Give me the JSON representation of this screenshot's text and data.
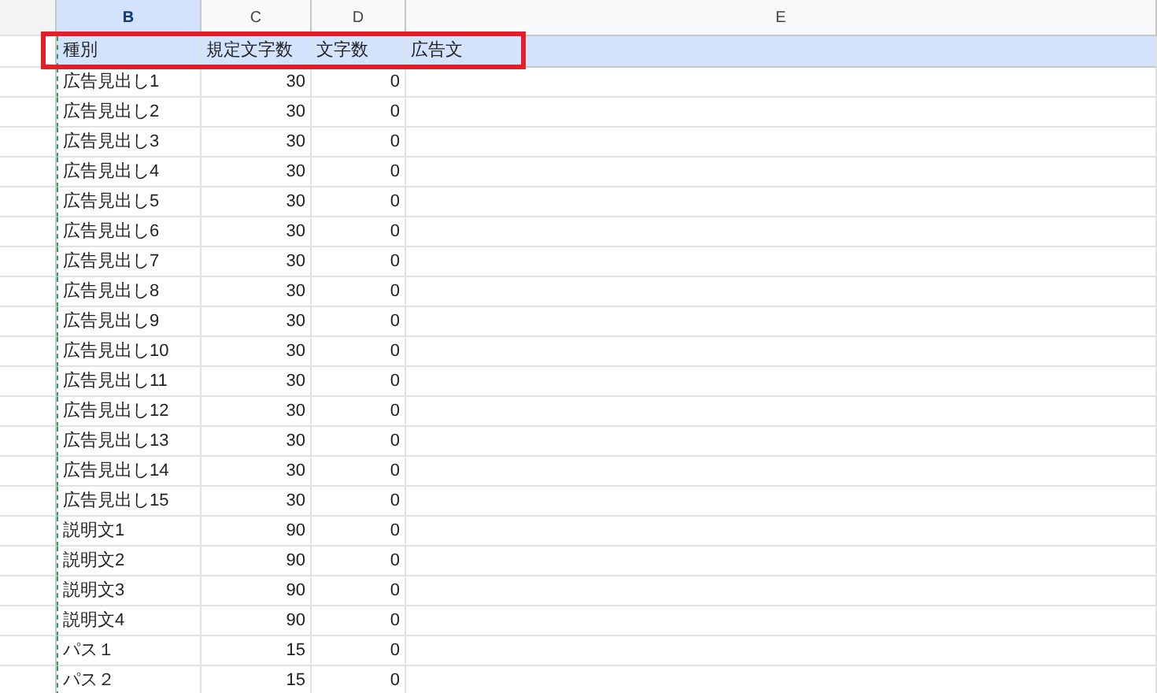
{
  "columns": [
    {
      "letter": "B",
      "selected": true
    },
    {
      "letter": "C",
      "selected": false
    },
    {
      "letter": "D",
      "selected": false
    },
    {
      "letter": "E",
      "selected": false
    }
  ],
  "header": [
    "種別",
    "規定文字数",
    "文字数",
    "広告文"
  ],
  "rows": [
    {
      "type": "広告見出し1",
      "limit": "30",
      "count": "0"
    },
    {
      "type": "広告見出し2",
      "limit": "30",
      "count": "0"
    },
    {
      "type": "広告見出し3",
      "limit": "30",
      "count": "0"
    },
    {
      "type": "広告見出し4",
      "limit": "30",
      "count": "0"
    },
    {
      "type": "広告見出し5",
      "limit": "30",
      "count": "0"
    },
    {
      "type": "広告見出し6",
      "limit": "30",
      "count": "0"
    },
    {
      "type": "広告見出し7",
      "limit": "30",
      "count": "0"
    },
    {
      "type": "広告見出し8",
      "limit": "30",
      "count": "0"
    },
    {
      "type": "広告見出し9",
      "limit": "30",
      "count": "0"
    },
    {
      "type": "広告見出し10",
      "limit": "30",
      "count": "0"
    },
    {
      "type": "広告見出し11",
      "limit": "30",
      "count": "0"
    },
    {
      "type": "広告見出し12",
      "limit": "30",
      "count": "0"
    },
    {
      "type": "広告見出し13",
      "limit": "30",
      "count": "0"
    },
    {
      "type": "広告見出し14",
      "limit": "30",
      "count": "0"
    },
    {
      "type": "広告見出し15",
      "limit": "30",
      "count": "0"
    },
    {
      "type": "説明文1",
      "limit": "90",
      "count": "0"
    },
    {
      "type": "説明文2",
      "limit": "90",
      "count": "0"
    },
    {
      "type": "説明文3",
      "limit": "90",
      "count": "0"
    },
    {
      "type": "説明文4",
      "limit": "90",
      "count": "0"
    },
    {
      "type": "パス１",
      "limit": "15",
      "count": "0"
    },
    {
      "type": "パス２",
      "limit": "15",
      "count": "0"
    }
  ]
}
